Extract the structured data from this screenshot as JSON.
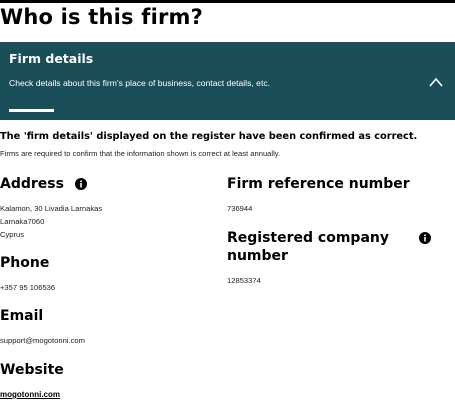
{
  "page": {
    "title": "Who is this firm?"
  },
  "firm_details_panel": {
    "title": "Firm details",
    "description": "Check details about this firm's place of business, contact details, etc.",
    "expanded": true
  },
  "confirmation": {
    "heading": "The 'firm details' displayed on the register have been confirmed as correct.",
    "subtext": "Firms are required to confirm that the information shown is correct at least annually."
  },
  "address": {
    "label": "Address",
    "lines": [
      "Kalamon, 30 Livadia Larnakas",
      "Larnaka7060",
      "Cyprus"
    ]
  },
  "phone": {
    "label": "Phone",
    "value": "+357 95 106536"
  },
  "email": {
    "label": "Email",
    "value": "support@mogotonni.com"
  },
  "website": {
    "label": "Website",
    "value": "mogotonni.com"
  },
  "firm_reference": {
    "label": "Firm reference number",
    "value": "736944"
  },
  "registered_company": {
    "label_line1": "Registered company",
    "label_line2": "number",
    "value": "12853374"
  },
  "colors": {
    "panel_bg": "#1a4f5a",
    "text": "#000000"
  },
  "icons": {
    "info": "info-icon",
    "chevron": "chevron-up-icon"
  }
}
